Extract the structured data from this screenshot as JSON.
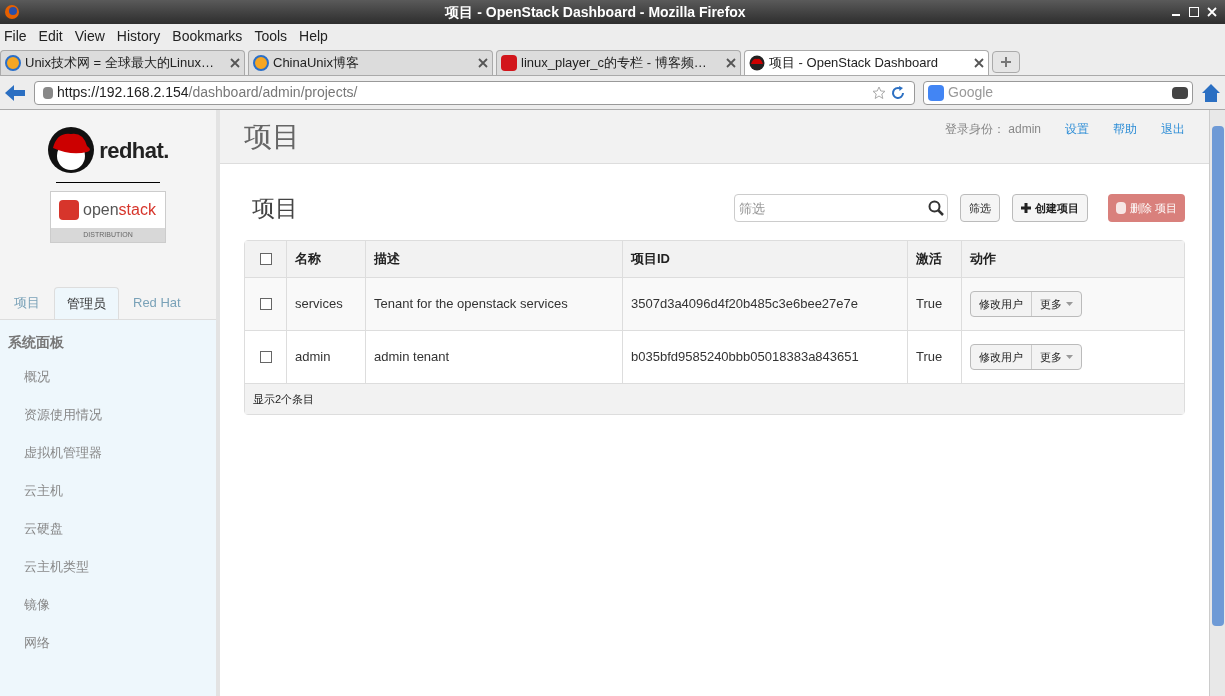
{
  "window": {
    "title": "项目 - OpenStack Dashboard - Mozilla Firefox"
  },
  "menu": [
    "File",
    "Edit",
    "View",
    "History",
    "Bookmarks",
    "Tools",
    "Help"
  ],
  "tabs": [
    {
      "label": "Unix技术网 = 全球最大的Linux…",
      "selected": false,
      "kind": "u"
    },
    {
      "label": "ChinaUnix博客",
      "selected": false,
      "kind": "u"
    },
    {
      "label": "linux_player_c的专栏 - 博客频…",
      "selected": false,
      "kind": "c"
    },
    {
      "label": "项目 - OpenStack Dashboard",
      "selected": true,
      "kind": "hat"
    }
  ],
  "url": {
    "host": "https://192.168.2.154",
    "path": "/dashboard/admin/projects/"
  },
  "search": {
    "placeholder": "Google"
  },
  "sidebar": {
    "logo_text": "redhat.",
    "product": {
      "open": "open",
      "stack": "stack",
      "sub": "DISTRIBUTION"
    },
    "tabs": [
      {
        "label": "项目",
        "selected": false
      },
      {
        "label": "管理员",
        "selected": true
      },
      {
        "label": "Red Hat",
        "selected": false
      }
    ],
    "section": "系统面板",
    "items": [
      "概况",
      "资源使用情况",
      "虚拟机管理器",
      "云主机",
      "云硬盘",
      "云主机类型",
      "镜像",
      "网络"
    ]
  },
  "header": {
    "title": "项目",
    "login_label": "登录身份：",
    "user": "admin",
    "links": [
      "设置",
      "帮助",
      "退出"
    ]
  },
  "panel": {
    "title": "项目",
    "filter": {
      "placeholder": "筛选"
    },
    "filter_button": "筛选",
    "create_button": "创建项目",
    "delete_button": "删除 项目"
  },
  "table": {
    "select_all": false,
    "columns": [
      "名称",
      "描述",
      "项目ID",
      "激活",
      "动作"
    ],
    "rows": [
      {
        "checked": false,
        "cells": [
          "services",
          "Tenant for the openstack services",
          "3507d3a4096d4f20b485c3e6bee27e7e",
          "True"
        ],
        "actions": [
          "修改用户",
          "更多"
        ]
      },
      {
        "checked": false,
        "cells": [
          "admin",
          "admin tenant",
          "b035bfd9585240bbb05018383a843651",
          "True"
        ],
        "actions": [
          "修改用户",
          "更多"
        ]
      }
    ],
    "footer": "显示2个条目"
  }
}
